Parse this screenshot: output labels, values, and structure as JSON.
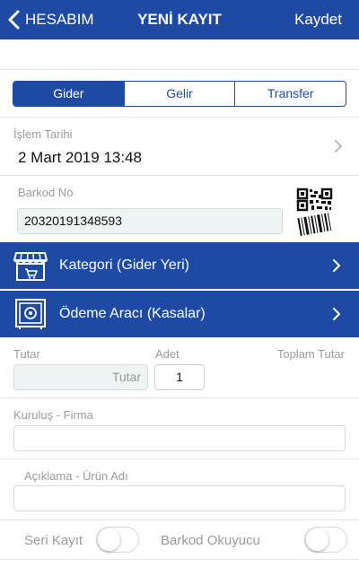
{
  "navbar": {
    "back_label": "HESABIM",
    "title": "YENİ KAYIT",
    "save_label": "Kaydet",
    "color": "#1f4aa3"
  },
  "segments": [
    {
      "label": "Gider",
      "active": true
    },
    {
      "label": "Gelir",
      "active": false
    },
    {
      "label": "Transfer",
      "active": false
    }
  ],
  "date": {
    "label": "İşlem Tarihi",
    "value": "2 Mart 2019 13:48"
  },
  "barcode": {
    "label": "Barkod No",
    "value": "20320191348593"
  },
  "category_row": {
    "label": "Kategori (Gider Yeri)"
  },
  "payment_row": {
    "label": "Ödeme Aracı (Kasalar)"
  },
  "amount": {
    "tutar_label": "Tutar",
    "tutar_placeholder": "Tutar",
    "adet_label": "Adet",
    "adet_value": "1",
    "total_label": "Toplam Tutar"
  },
  "company": {
    "label": "Kuruluş - Firma",
    "value": ""
  },
  "description": {
    "label": "Açıklama - Ürün Adı",
    "value": ""
  },
  "toggles": {
    "serial_label": "Seri Kayıt",
    "serial_on": false,
    "scanner_label": "Barkod Okuyucu",
    "scanner_on": false
  }
}
